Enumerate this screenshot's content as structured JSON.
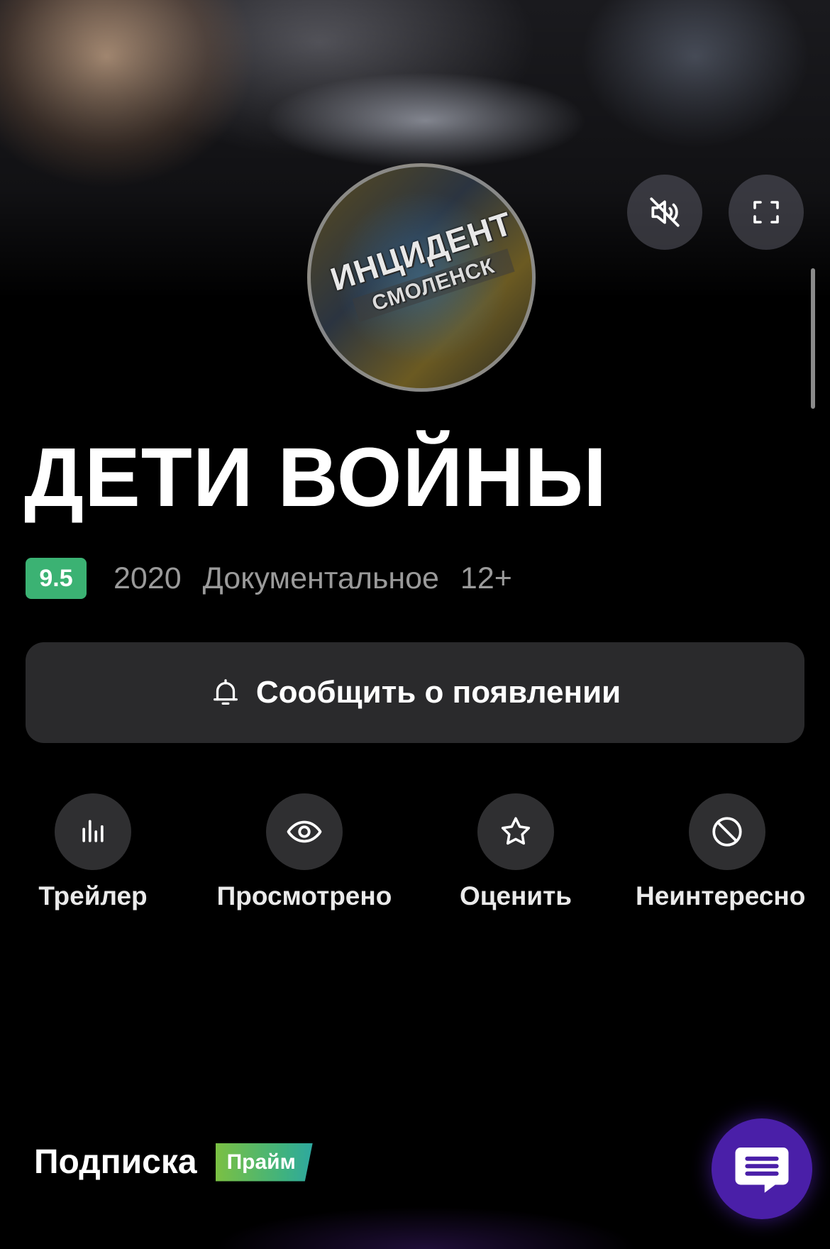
{
  "hero": {
    "logo": {
      "line1": "ИНЦИДЕНТ",
      "line2": "СМОЛЕНСК"
    },
    "controls": {
      "mute_icon": "speaker-muted-icon",
      "fullscreen_icon": "fullscreen-icon"
    }
  },
  "movie": {
    "title": "ДЕТИ ВОЙНЫ",
    "rating": "9.5",
    "year": "2020",
    "genre": "Документальное",
    "age": "12+"
  },
  "notify_button": {
    "label": "Сообщить о появлении",
    "icon": "bell-icon"
  },
  "actions": [
    {
      "label": "Трейлер",
      "icon": "equalizer-icon"
    },
    {
      "label": "Просмотрено",
      "icon": "eye-icon"
    },
    {
      "label": "Оценить",
      "icon": "star-icon"
    },
    {
      "label": "Неинтересно",
      "icon": "ban-icon"
    }
  ],
  "subscription": {
    "label": "Подписка",
    "badge": "Прайм"
  },
  "chat_button": {
    "icon": "chat-icon"
  },
  "colors": {
    "rating_green": "#3bb273",
    "chat_purple": "#4a1fa8",
    "button_bg": "#2a2a2c"
  }
}
